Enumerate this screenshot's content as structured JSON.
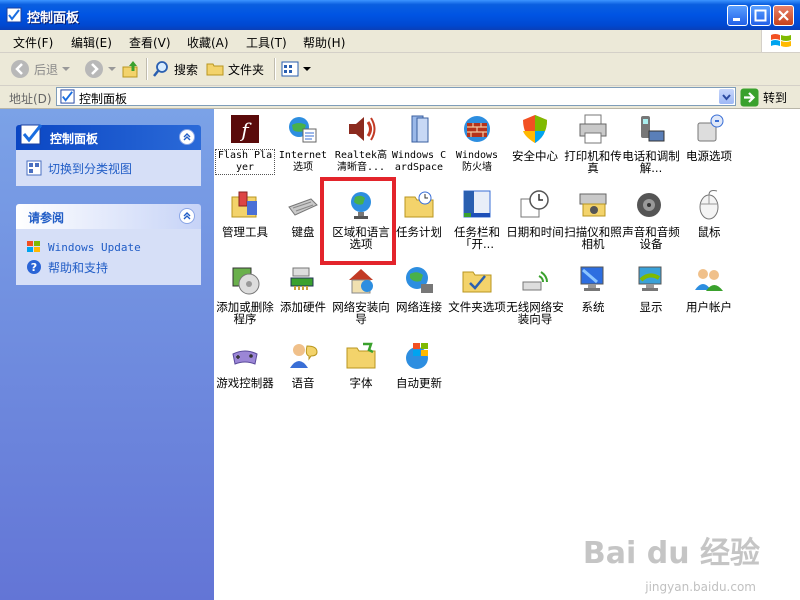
{
  "window": {
    "title": "控制面板"
  },
  "menu": [
    "文件(F)",
    "编辑(E)",
    "查看(V)",
    "收藏(A)",
    "工具(T)",
    "帮助(H)"
  ],
  "toolbar": {
    "back": "后退",
    "search": "搜索",
    "folders": "文件夹"
  },
  "address": {
    "label": "地址(D)",
    "value": "控制面板",
    "go": "转到"
  },
  "sidebar": {
    "control_panel": {
      "title": "控制面板",
      "link": "切换到分类视图"
    },
    "see_also": {
      "title": "请参阅",
      "links": [
        "Windows Update",
        "帮助和支持"
      ]
    }
  },
  "items": [
    "Flash Player",
    "Internet 选项",
    "Realtek高清晰音...",
    "Windows CardSpace",
    "Windows 防火墙",
    "安全中心",
    "打印机和传真",
    "电话和调制解...",
    "电源选项",
    "管理工具",
    "键盘",
    "区域和语言选项",
    "任务计划",
    "任务栏和「开...",
    "日期和时间",
    "扫描仪和照相机",
    "声音和音频设备",
    "鼠标",
    "添加或删除程序",
    "添加硬件",
    "网络安装向导",
    "网络连接",
    "文件夹选项",
    "无线网络安装向导",
    "系统",
    "显示",
    "用户帐户",
    "游戏控制器",
    "语音",
    "字体",
    "自动更新"
  ],
  "colors": {
    "title_bar": "#0054e3",
    "highlight": "#e3242b",
    "sidebar": "#6f8fe0"
  },
  "watermark": {
    "brand": "Bai du 经验",
    "url": "jingyan.baidu.com"
  }
}
